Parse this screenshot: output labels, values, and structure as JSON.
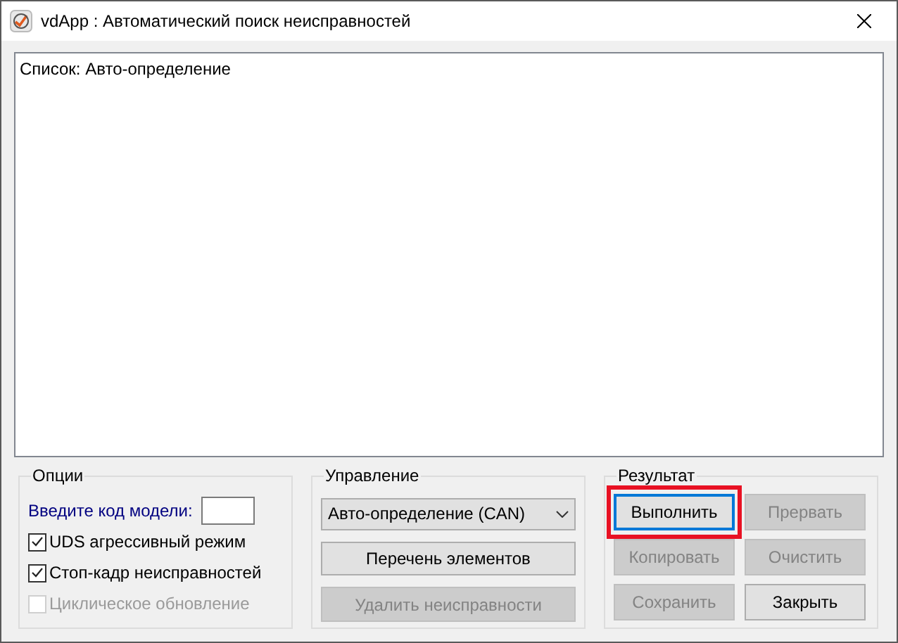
{
  "window": {
    "title": "vdApp :  Автоматический поиск неисправностей"
  },
  "list": {
    "lines": [
      "Список: Авто-определение"
    ]
  },
  "options": {
    "title": "Опции",
    "model_label": "Введите код модели:",
    "checkboxes": [
      {
        "label": "UDS агрессивный режим",
        "checked": true,
        "disabled": false
      },
      {
        "label": "Стоп-кадр неисправностей",
        "checked": true,
        "disabled": false
      },
      {
        "label": "Циклическое обновление",
        "checked": false,
        "disabled": true
      }
    ]
  },
  "control": {
    "title": "Управление",
    "dropdown": "Авто-определение (CAN)",
    "buttons": [
      {
        "label": "Перечень элементов",
        "disabled": false
      },
      {
        "label": "Удалить неисправности",
        "disabled": true
      }
    ]
  },
  "result": {
    "title": "Результат",
    "buttons": [
      {
        "label": "Выполнить",
        "disabled": false,
        "focused": true,
        "highlighted": true
      },
      {
        "label": "Прервать",
        "disabled": true,
        "focused": false,
        "highlighted": false
      },
      {
        "label": "Копировать",
        "disabled": true,
        "focused": false,
        "highlighted": false
      },
      {
        "label": "Очистить",
        "disabled": true,
        "focused": false,
        "highlighted": false
      },
      {
        "label": "Сохранить",
        "disabled": true,
        "focused": false,
        "highlighted": false
      },
      {
        "label": "Закрыть",
        "disabled": false,
        "focused": false,
        "highlighted": false
      }
    ]
  }
}
